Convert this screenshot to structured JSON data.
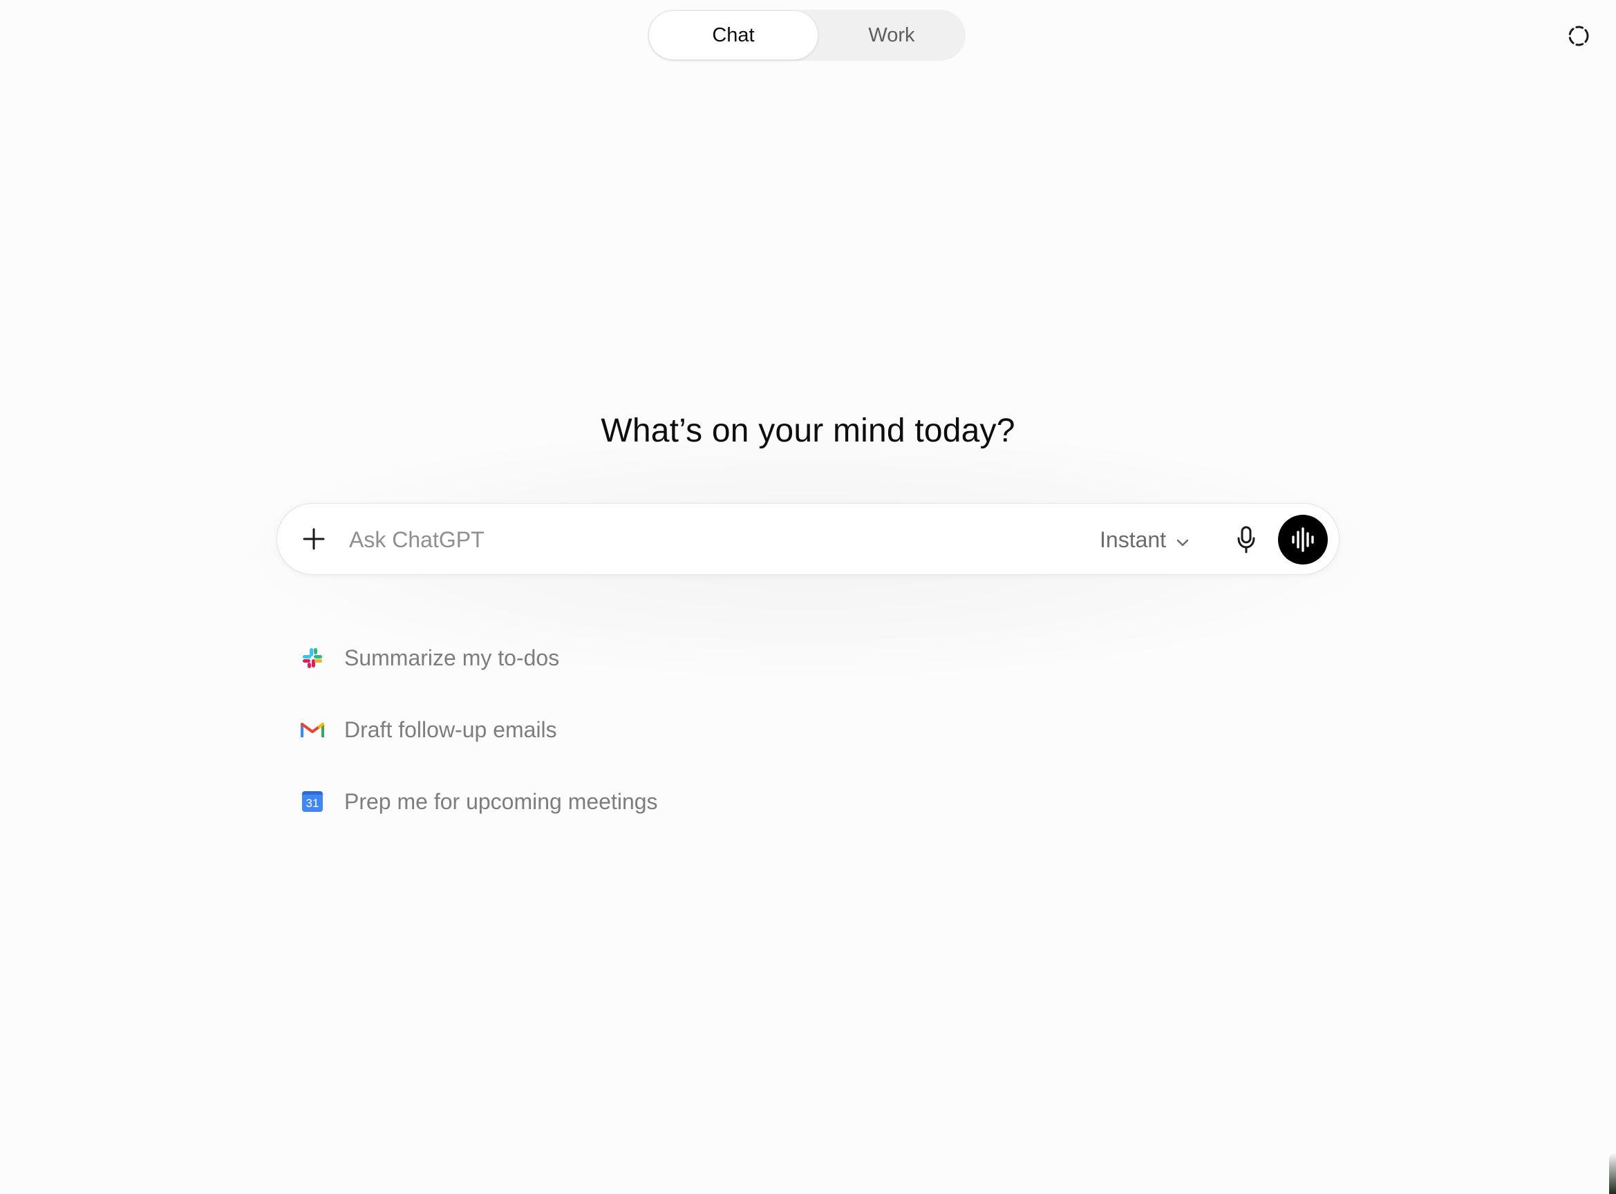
{
  "mode_switch": {
    "tabs": [
      {
        "label": "Chat",
        "active": true
      },
      {
        "label": "Work",
        "active": false
      }
    ]
  },
  "corner_icon": {
    "name": "dashed-circle-icon"
  },
  "headline": "What’s on your mind today?",
  "composer": {
    "placeholder": "Ask ChatGPT",
    "value": "",
    "plus_icon": "plus-icon",
    "model_label": "Instant",
    "model_icon": "chevron-down-icon",
    "mic_icon": "microphone-icon",
    "voice_icon": "voice-waveform-icon"
  },
  "suggestions": [
    {
      "label": "Summarize my to-dos",
      "icon": "slack-icon"
    },
    {
      "label": "Draft follow-up emails",
      "icon": "gmail-icon"
    },
    {
      "label": "Prep me for upcoming meetings",
      "icon": "google-calendar-icon",
      "icon_text": "31"
    }
  ],
  "colors": {
    "background": "#fcfcfc",
    "voice_button": "#000000",
    "muted_text": "#7d7d7d"
  }
}
